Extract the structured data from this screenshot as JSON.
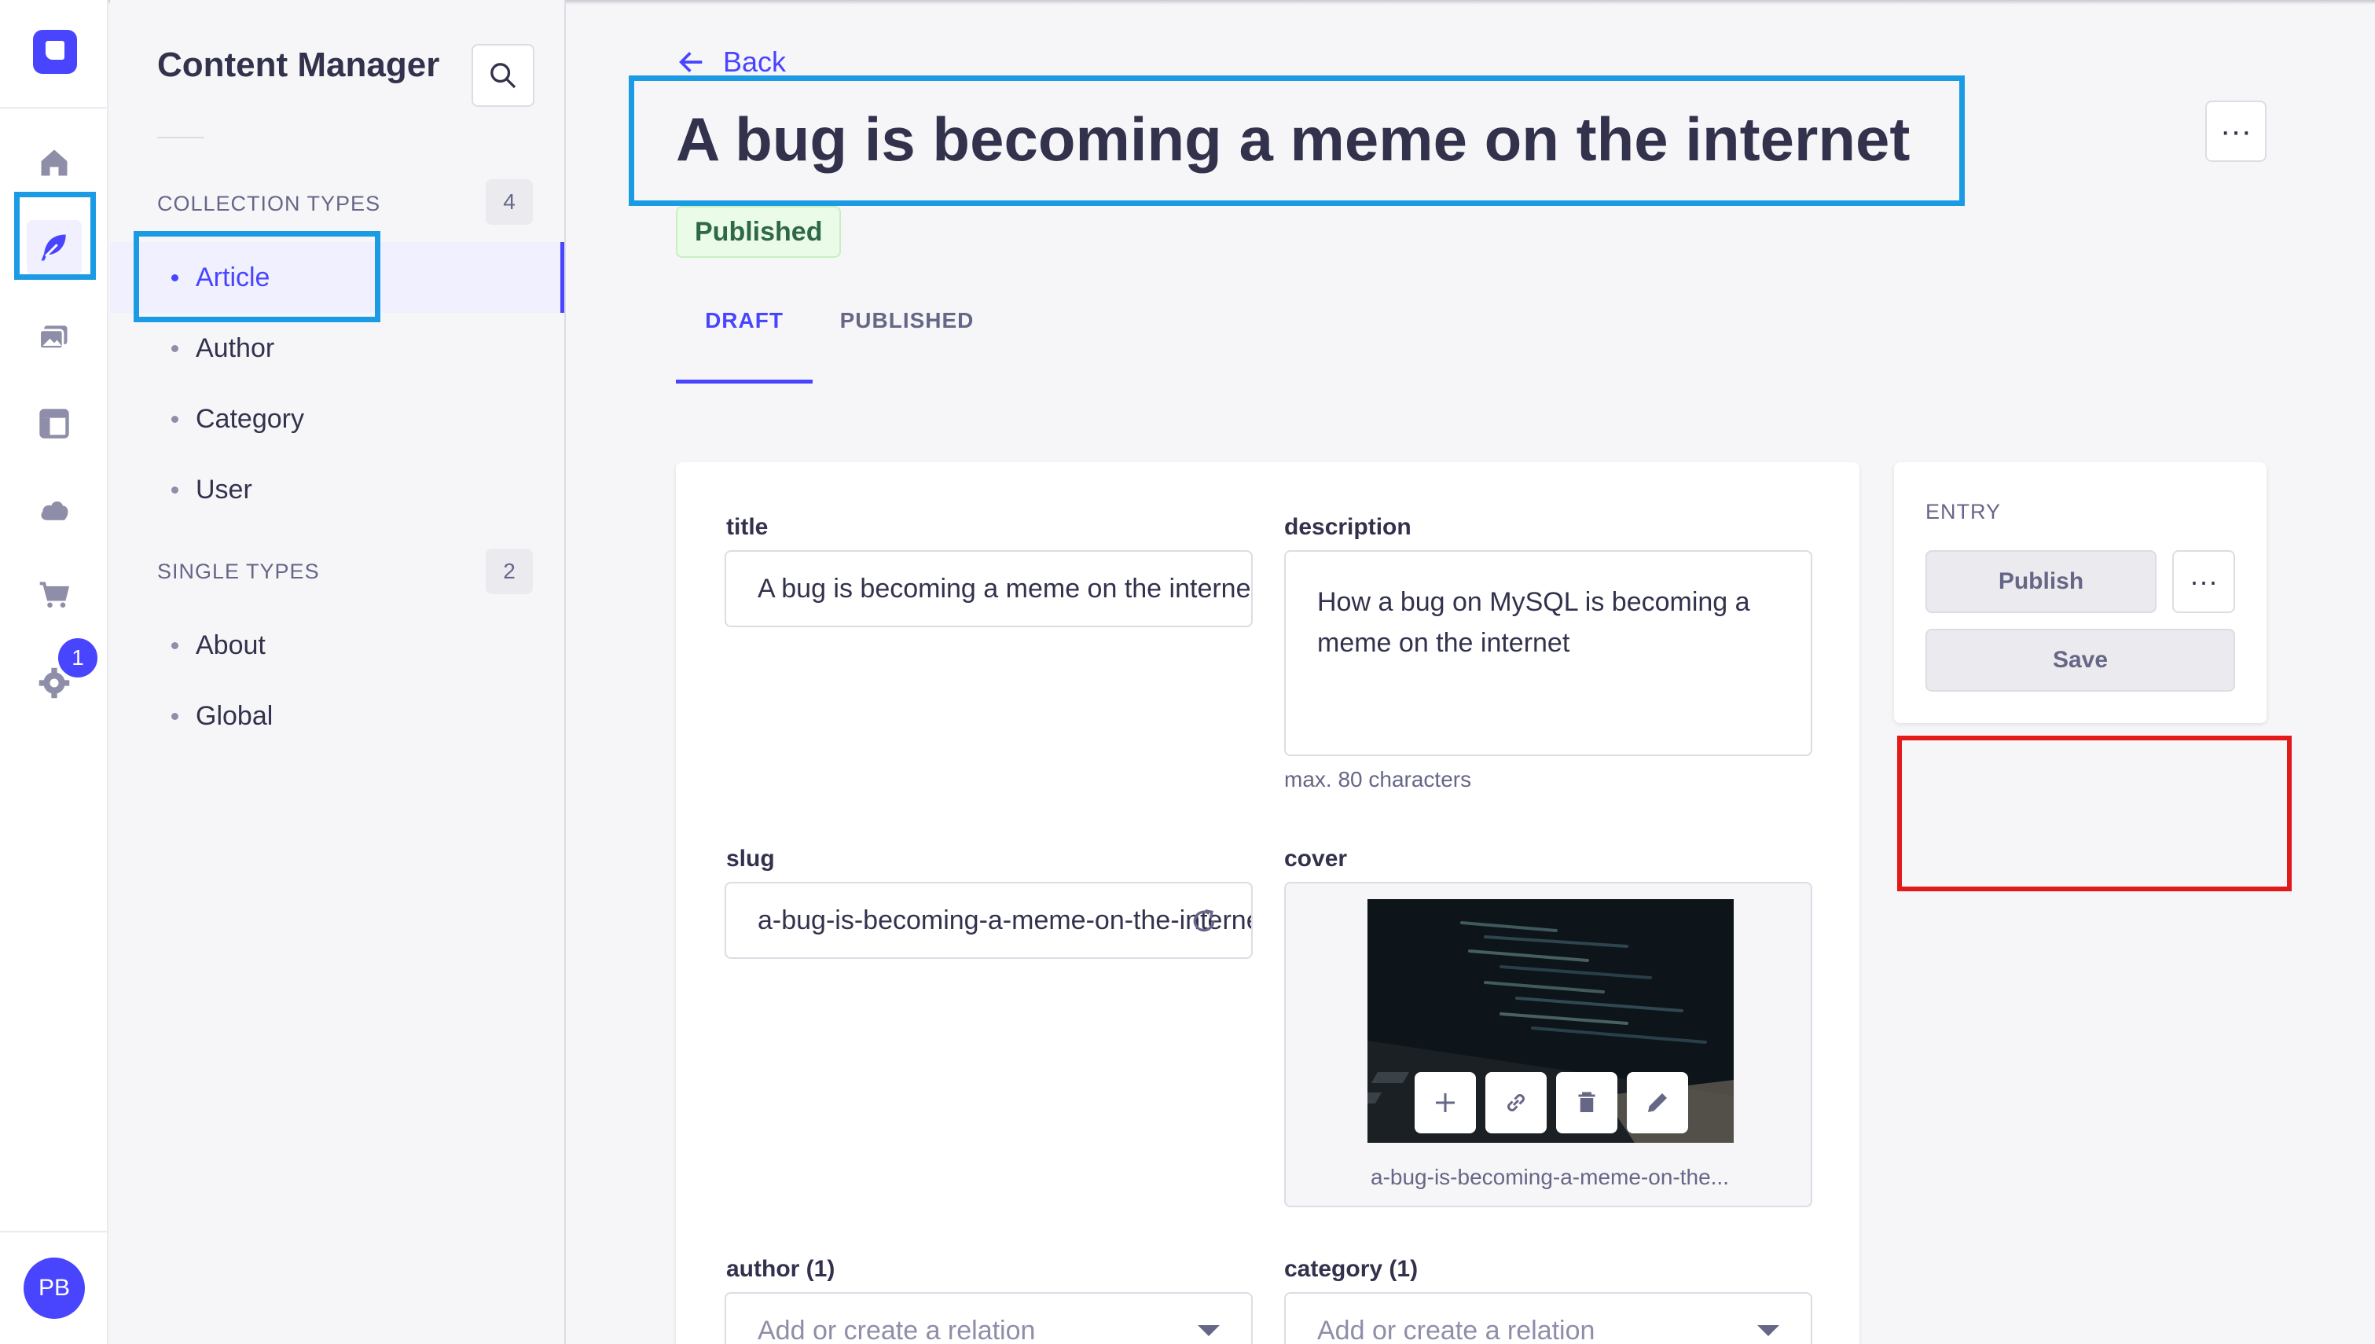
{
  "rail": {
    "icons": [
      "strapi-logo-icon",
      "home-icon",
      "feather-icon",
      "media-icon",
      "layout-icon",
      "cloud-icon",
      "cart-icon",
      "gear-icon"
    ],
    "settings_badge": "1",
    "user_initials": "PB",
    "brand_color": "#4945ff"
  },
  "sidebar": {
    "title": "Content Manager",
    "collection_types_label": "COLLECTION TYPES",
    "collection_types_count": "4",
    "collection_types": [
      {
        "label": "Article",
        "active": true
      },
      {
        "label": "Author",
        "active": false
      },
      {
        "label": "Category",
        "active": false
      },
      {
        "label": "User",
        "active": false
      }
    ],
    "single_types_label": "SINGLE TYPES",
    "single_types_count": "2",
    "single_types": [
      {
        "label": "About"
      },
      {
        "label": "Global"
      }
    ]
  },
  "header": {
    "back_label": "Back",
    "title": "A bug is becoming a meme on the internet",
    "more_label": "···",
    "status": "Published",
    "tabs": [
      {
        "label": "DRAFT",
        "active": true
      },
      {
        "label": "PUBLISHED",
        "active": false
      }
    ]
  },
  "form": {
    "title_label": "title",
    "title_value": "A bug is becoming a meme on the internet",
    "description_label": "description",
    "description_value": "How a bug on MySQL is becoming a meme on the internet",
    "description_hint": "max. 80 characters",
    "slug_label": "slug",
    "slug_value": "a-bug-is-becoming-a-meme-on-the-internet",
    "cover_label": "cover",
    "cover_filename": "a-bug-is-becoming-a-meme-on-the...",
    "author_label": "author (1)",
    "author_placeholder": "Add or create a relation",
    "category_label": "category (1)",
    "category_placeholder": "Add or create a relation"
  },
  "entry": {
    "label": "ENTRY",
    "publish_label": "Publish",
    "more_label": "···",
    "save_label": "Save"
  },
  "annotations": {
    "highlight_blue": "#1a9be4",
    "highlight_red": "#e21a1a"
  }
}
